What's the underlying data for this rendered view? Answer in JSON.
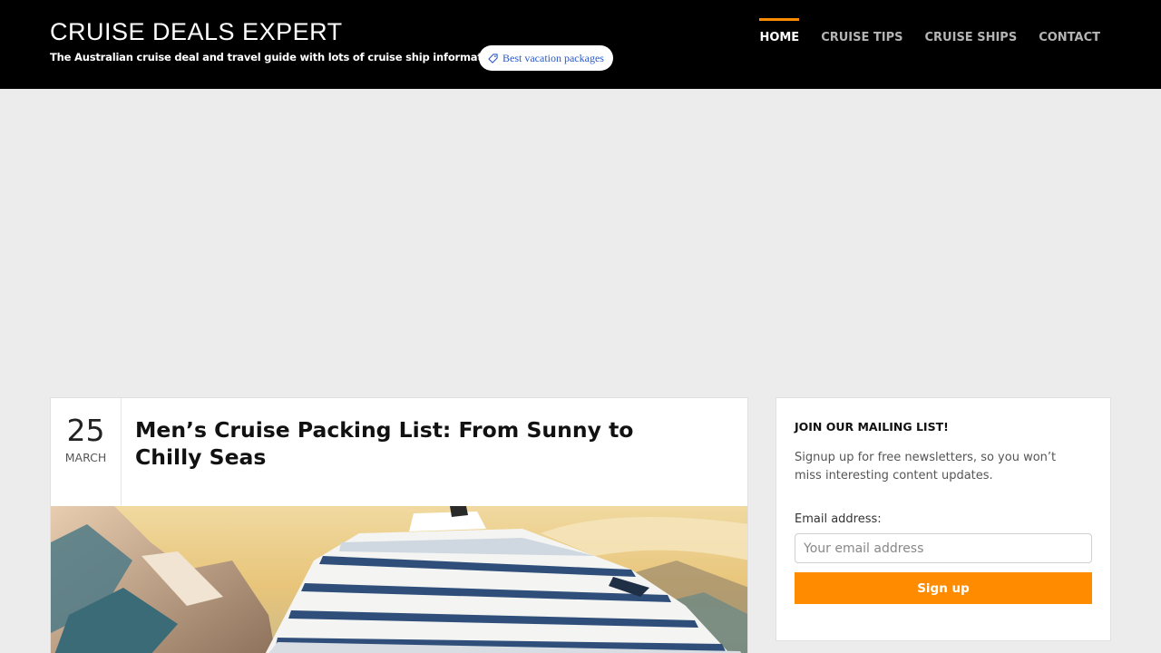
{
  "header": {
    "site_title": "CRUISE DEALS EXPERT",
    "tagline": "The Australian cruise deal and travel guide with lots of cruise ship information.",
    "pill_label": "Best vacation packages",
    "pill_icon": "tag-icon"
  },
  "nav": {
    "items": [
      {
        "label": "HOME",
        "active": true
      },
      {
        "label": "CRUISE TIPS",
        "active": false
      },
      {
        "label": "CRUISE SHIPS",
        "active": false
      },
      {
        "label": "CONTACT",
        "active": false
      }
    ],
    "active_color": "#ff8c00"
  },
  "post": {
    "day": "25",
    "month": "MARCH",
    "title": "Men’s Cruise Packing List: From Sunny to Chilly Seas",
    "image_subject": "cruise-ship-illustration"
  },
  "mailing": {
    "title": "JOIN OUR MAILING LIST!",
    "description": "Signup up for free newsletters, so you won’t miss interesting content updates.",
    "email_label": "Email address:",
    "email_placeholder": "Your email address",
    "button_label": "Sign up",
    "accent_color": "#ff8c00"
  }
}
